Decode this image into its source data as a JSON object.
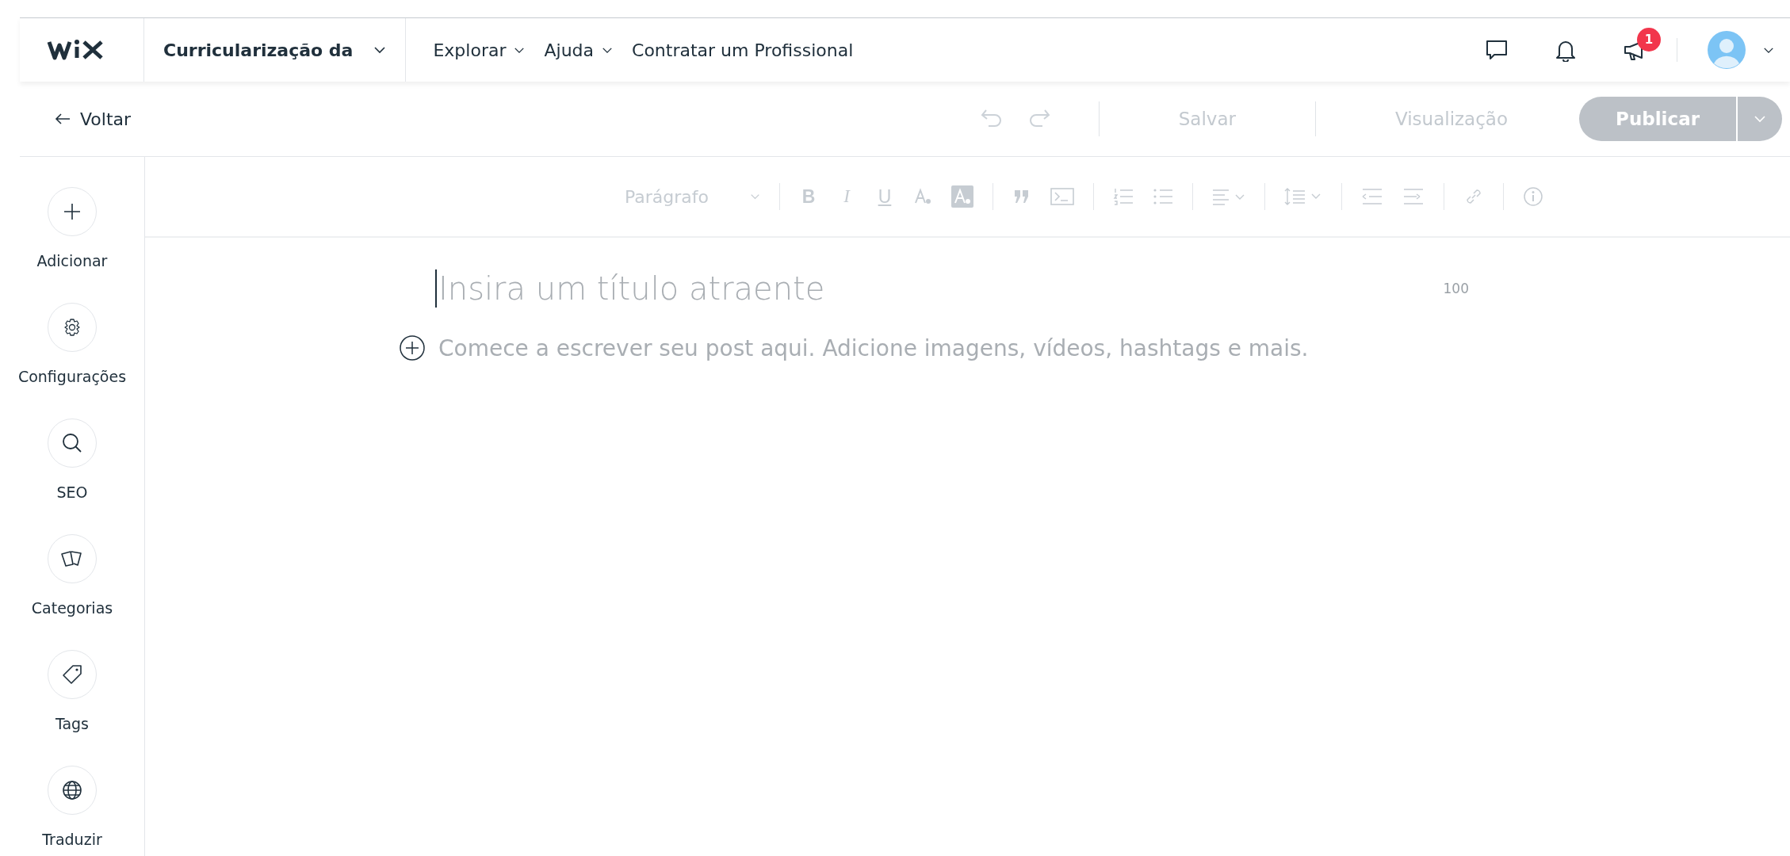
{
  "top_nav": {
    "site_selector": "Curricularização da",
    "menus": [
      {
        "label": "Explorar",
        "dropdown": true
      },
      {
        "label": "Ajuda",
        "dropdown": true
      },
      {
        "label": "Contratar um Profissional",
        "dropdown": false
      }
    ],
    "notification_badge": "1"
  },
  "action_bar": {
    "back": "Voltar",
    "undo_disabled": true,
    "redo_disabled": true,
    "save": {
      "label": "Salvar",
      "disabled": true
    },
    "preview": {
      "label": "Visualização",
      "disabled": true
    },
    "publish": {
      "label": "Publicar",
      "disabled": true
    }
  },
  "sidebar": {
    "items": [
      {
        "label": "Adicionar"
      },
      {
        "label": "Configurações"
      },
      {
        "label": "SEO"
      },
      {
        "label": "Categorias"
      },
      {
        "label": "Tags"
      },
      {
        "label": "Traduzir"
      }
    ]
  },
  "toolbar": {
    "paragraph_style": "Parágrafo",
    "format_buttons": [
      "B",
      "I",
      "U"
    ],
    "disabled": true
  },
  "editor": {
    "title_placeholder": "Insira um título atraente",
    "title_counter": "100",
    "body_placeholder": "Comece a escrever seu post aqui. Adicione imagens, vídeos, hashtags e mais."
  }
}
